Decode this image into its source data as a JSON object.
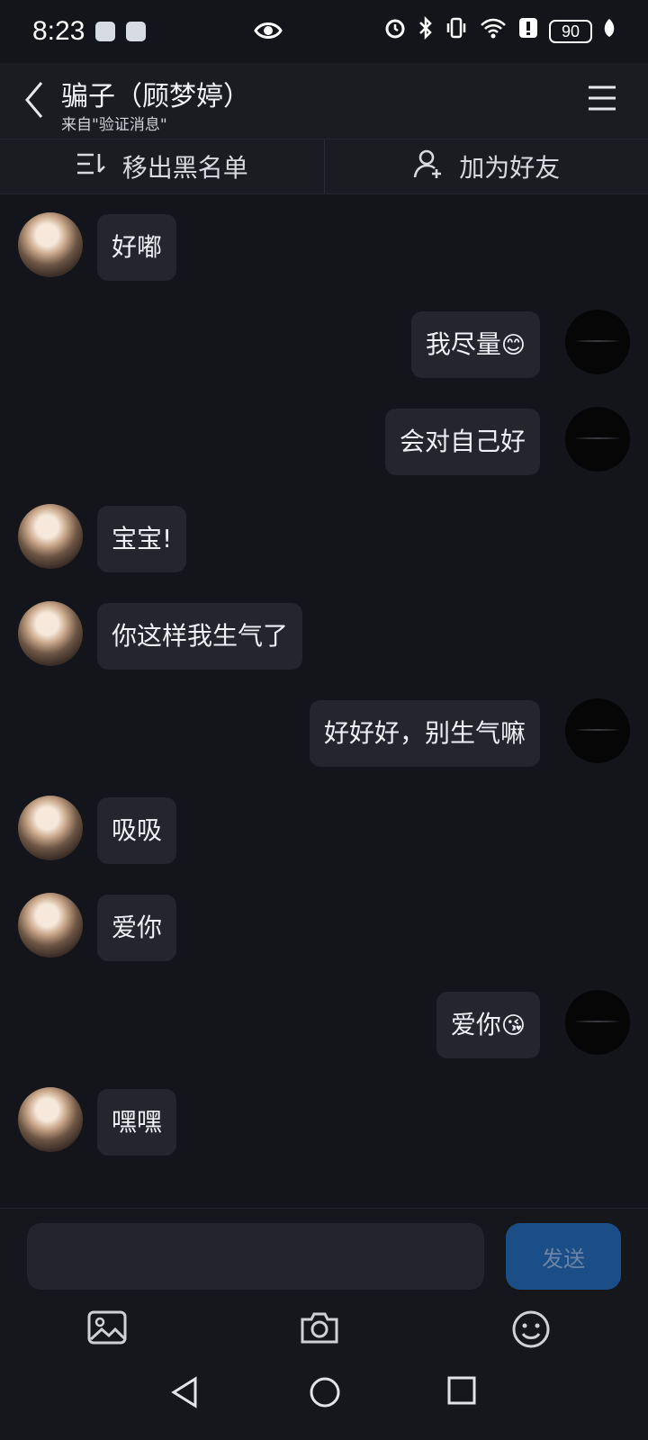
{
  "status": {
    "time": "8:23",
    "battery": "90"
  },
  "header": {
    "title": "骗子（顾梦婷）",
    "subtitle": "来自\"验证消息\""
  },
  "actions": {
    "remove_blacklist": "移出黑名单",
    "add_friend": "加为好友"
  },
  "messages": [
    {
      "from": "them",
      "text": "好嘟"
    },
    {
      "from": "me",
      "text": "我尽量",
      "emoji": "😊"
    },
    {
      "from": "me",
      "text": "会对自己好"
    },
    {
      "from": "them",
      "text": "宝宝!"
    },
    {
      "from": "them",
      "text": "你这样我生气了"
    },
    {
      "from": "me",
      "text": "好好好，别生气嘛"
    },
    {
      "from": "them",
      "text": "吸吸"
    },
    {
      "from": "them",
      "text": "爱你"
    },
    {
      "from": "me",
      "text": "爱你",
      "emoji": "😘"
    },
    {
      "from": "them",
      "text": "嘿嘿"
    }
  ],
  "composer": {
    "placeholder": "",
    "send_label": "发送"
  },
  "icons": {
    "back": "back-arrow-icon",
    "menu": "hamburger-menu-icon",
    "image": "image-icon",
    "camera": "camera-icon",
    "emoji": "emoji-icon"
  },
  "colors": {
    "background": "#14151a",
    "bubble": "#25262d",
    "send_button": "#1b4e86"
  }
}
